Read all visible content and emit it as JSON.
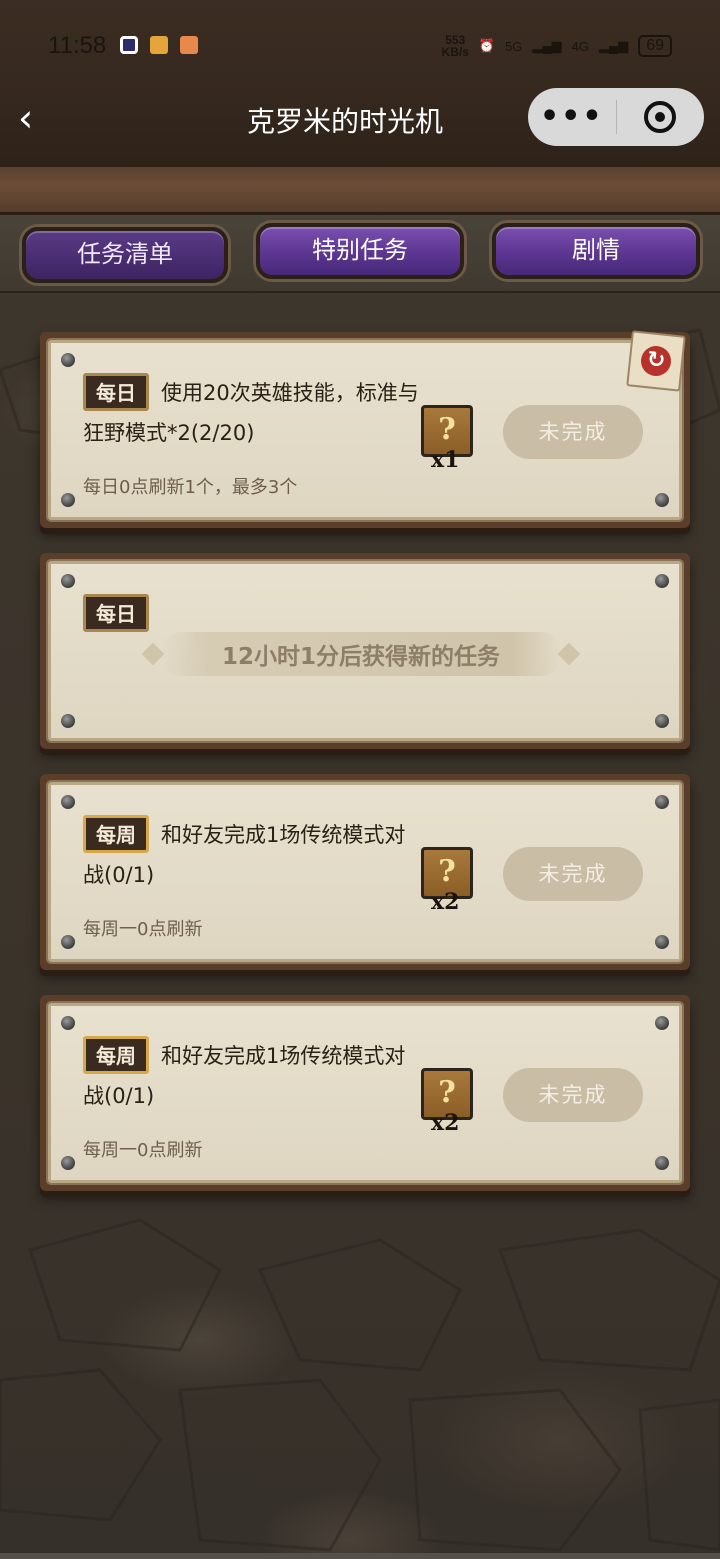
{
  "status_bar": {
    "time": "11:58",
    "net_speed_value": "553",
    "net_speed_unit": "KB/s",
    "signal_1": "5G",
    "signal_2": "4G",
    "battery": "69"
  },
  "nav": {
    "back_icon": "chevron-left-icon",
    "title": "克罗米的时光机",
    "more_label": "•••",
    "close_icon": "target-icon"
  },
  "tabs": [
    {
      "label": "任务清单",
      "active": true
    },
    {
      "label": "特别任务",
      "active": false
    },
    {
      "label": "剧情",
      "active": false
    }
  ],
  "quests": [
    {
      "badge": "每日",
      "title": "使用20次英雄技能，标准与狂野模式*2(2/20)",
      "subtitle": "每日0点刷新1个，最多3个",
      "reward_icon": "?",
      "reward_count": "x1",
      "status": "未完成"
    },
    {
      "badge": "每日",
      "pending_text": "12小时1分后获得新的任务"
    },
    {
      "badge": "每周",
      "title": "和好友完成1场传统模式对战(0/1)",
      "subtitle": "每周一0点刷新",
      "reward_icon": "?",
      "reward_count": "x2",
      "status": "未完成"
    },
    {
      "badge": "每周",
      "title": "和好友完成1场传统模式对战(0/1)",
      "subtitle": "每周一0点刷新",
      "reward_icon": "?",
      "reward_count": "x2",
      "status": "未完成"
    }
  ],
  "colors": {
    "tab_purple": "#5c3690",
    "card_parchment": "#e8e1cf",
    "status_button": "#c9bda6"
  }
}
